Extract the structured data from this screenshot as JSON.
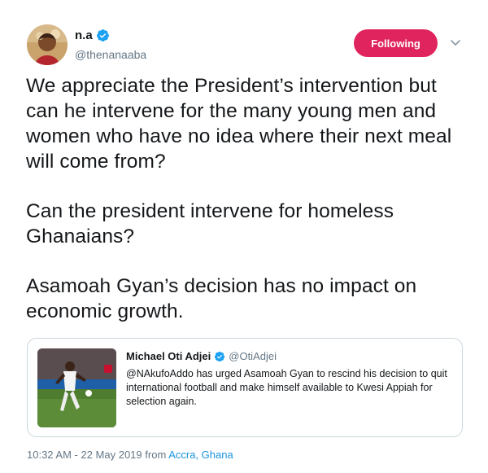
{
  "author": {
    "display_name": "n.a",
    "handle": "@thenanaaba",
    "avatar_icon": "profile-photo",
    "verified_icon": "verified-badge-icon"
  },
  "follow_button": {
    "label": "Following",
    "color": "#e0245e"
  },
  "menu_icon": "chevron-down-icon",
  "tweet": {
    "paragraphs": [
      "We appreciate the President’s intervention but can he intervene for the many young men and women who have no idea where their next meal will come from?",
      "Can the president intervene for homeless Ghanaians?",
      "Asamoah Gyan’s decision has no impact on economic growth."
    ]
  },
  "quoted_tweet": {
    "display_name": "Michael Oti Adjei",
    "handle": "@OtiAdjei",
    "text": "@NAkufoAddo has urged Asamoah Gyan to rescind his decision to quit international football and make himself available to Kwesi Appiah for selection again.",
    "image_icon": "football-player-photo"
  },
  "meta": {
    "timestamp": "10:32 AM - 22 May 2019",
    "from_label": "from",
    "location": "Accra, Ghana"
  },
  "colors": {
    "text": "#14171a",
    "secondary": "#657786",
    "link": "#1b95e0",
    "verified": "#1da1f2",
    "border": "#ccd6dd"
  }
}
